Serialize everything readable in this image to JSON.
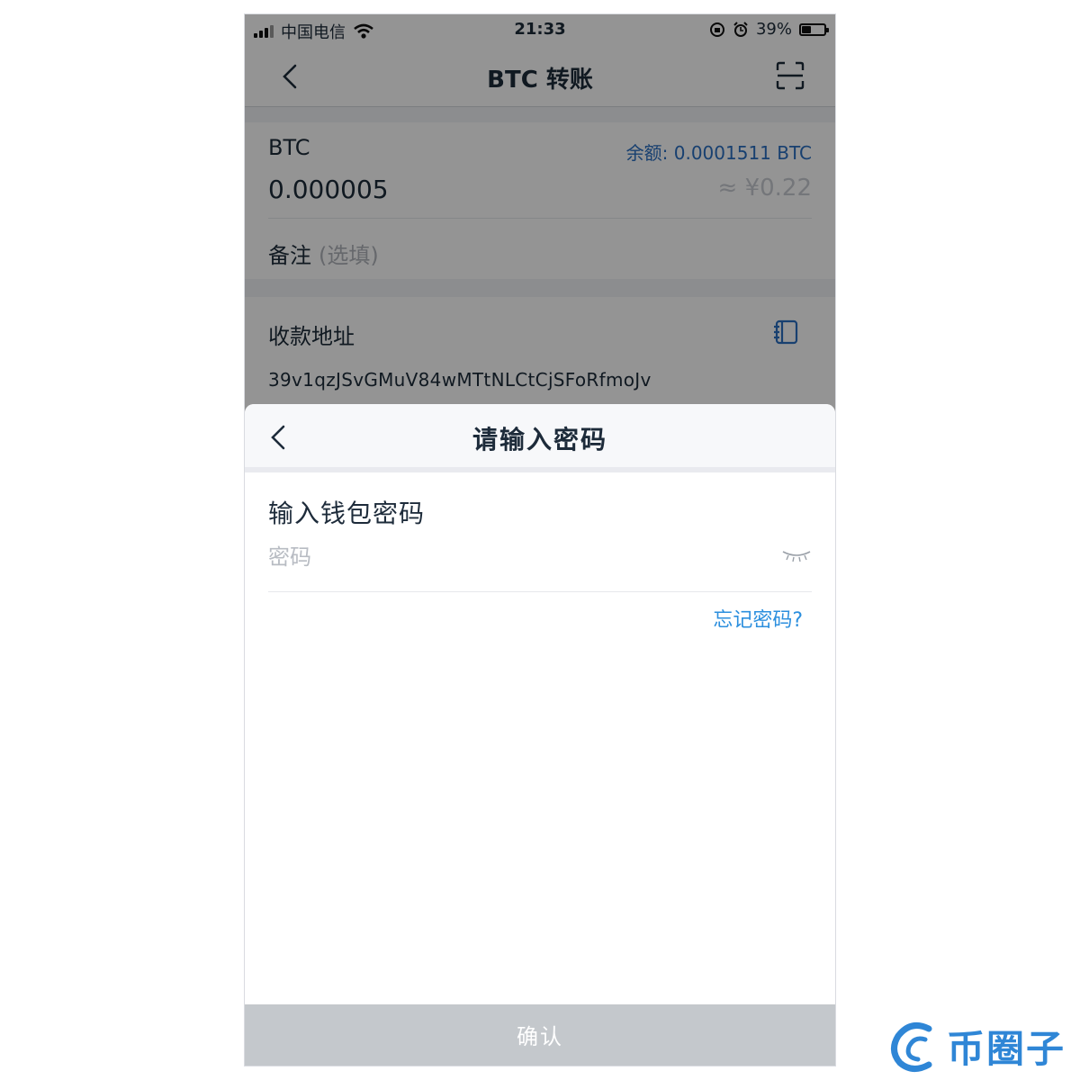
{
  "status_bar": {
    "carrier": "中国电信",
    "time": "21:33",
    "battery": "39%",
    "battery_level": 0.39
  },
  "nav": {
    "title": "BTC 转账",
    "back_icon": "chevron-left-icon",
    "scan_icon": "scan-icon"
  },
  "transfer": {
    "asset": "BTC",
    "balance": "余额: 0.0001511 BTC",
    "amount": "0.000005",
    "fiat": "≈ ¥0.22",
    "memo_label": "备注",
    "memo_placeholder": "(选填)",
    "address_label": "收款地址",
    "address_value": "39v1qzJSvGMuV84wMTtNLCtCjSFoRfmoJv",
    "address_book_icon": "address-book-icon"
  },
  "password_sheet": {
    "title": "请输入密码",
    "heading": "输入钱包密码",
    "placeholder": "密码",
    "forgot": "忘记密码?",
    "confirm": "确认",
    "eye_icon": "eye-closed-icon"
  },
  "watermark": {
    "text": "币圈子"
  },
  "colors": {
    "accent": "#2c8fde",
    "balance": "#2a6fc2",
    "confirm_disabled": "#c4c8cc",
    "watermark": "#2f86d6"
  }
}
